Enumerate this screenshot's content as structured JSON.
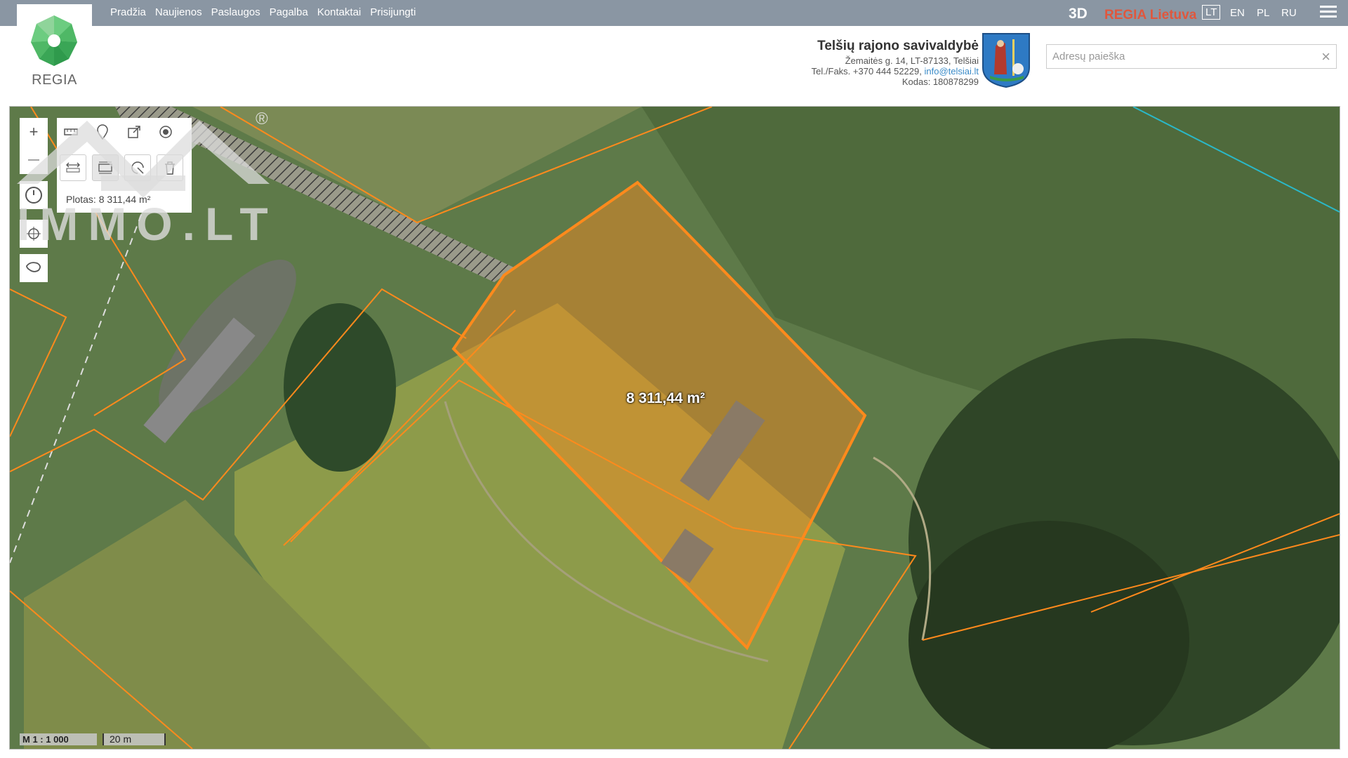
{
  "nav": [
    "Pradžia",
    "Naujienos",
    "Paslaugos",
    "Pagalba",
    "Kontaktai",
    "Prisijungti"
  ],
  "logo_text": "REGIA",
  "topright": {
    "mode_3d": "3D",
    "brand": "REGIA Lietuva",
    "languages": [
      "LT",
      "EN",
      "PL",
      "RU"
    ],
    "active_language": "LT"
  },
  "municipality": {
    "name": "Telšių rajono savivaldybė",
    "address": "Žemaitės g. 14, LT-87133, Telšiai",
    "phone_prefix": "Tel./Faks. +370 444 52229,",
    "email": "info@telsiai.lt",
    "code": "Kodas: 180878299"
  },
  "search": {
    "placeholder": "Adresų paieška",
    "value": "",
    "clear_icon": "×"
  },
  "map": {
    "area_label": "8 311,44 m²",
    "area_readout": "Plotas: 8 311,44 m²",
    "scale_ratio": "M 1 : 1 000",
    "scale_bar": "20 m",
    "parcel_color": "#ff8a1c",
    "watermark": "IMMO.LT",
    "watermark_mark": "®"
  },
  "tools": {
    "left_column": [
      "zoom-in-icon",
      "zoom-out-icon",
      "history-icon",
      "locate-icon",
      "lasso-icon"
    ],
    "panel_row1": [
      "ruler-icon",
      "pin-icon",
      "export-icon",
      "record-icon"
    ],
    "panel_row2": [
      "measure-distance-icon",
      "measure-area-icon",
      "measure-radius-icon",
      "trash-icon"
    ],
    "zoom_in": "+",
    "zoom_out": "—"
  }
}
